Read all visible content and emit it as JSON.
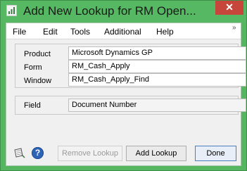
{
  "window": {
    "title": "Add New Lookup for RM Open...",
    "close_glyph": "✕",
    "accent_color": "#55b65f"
  },
  "menubar": {
    "items": [
      "File",
      "Edit",
      "Tools",
      "Additional",
      "Help"
    ],
    "overflow_glyph": "»"
  },
  "details": {
    "product": {
      "label": "Product",
      "value": "Microsoft Dynamics GP"
    },
    "form": {
      "label": "Form",
      "value": "RM_Cash_Apply"
    },
    "window": {
      "label": "Window",
      "value": "RM_Cash_Apply_Find"
    }
  },
  "field": {
    "label": "Field",
    "value": "Document Number"
  },
  "footer": {
    "remove_lookup_label": "Remove Lookup",
    "add_lookup_label": "Add Lookup",
    "done_label": "Done",
    "help_glyph": "?",
    "icons": [
      "note-icon",
      "help-icon"
    ]
  }
}
